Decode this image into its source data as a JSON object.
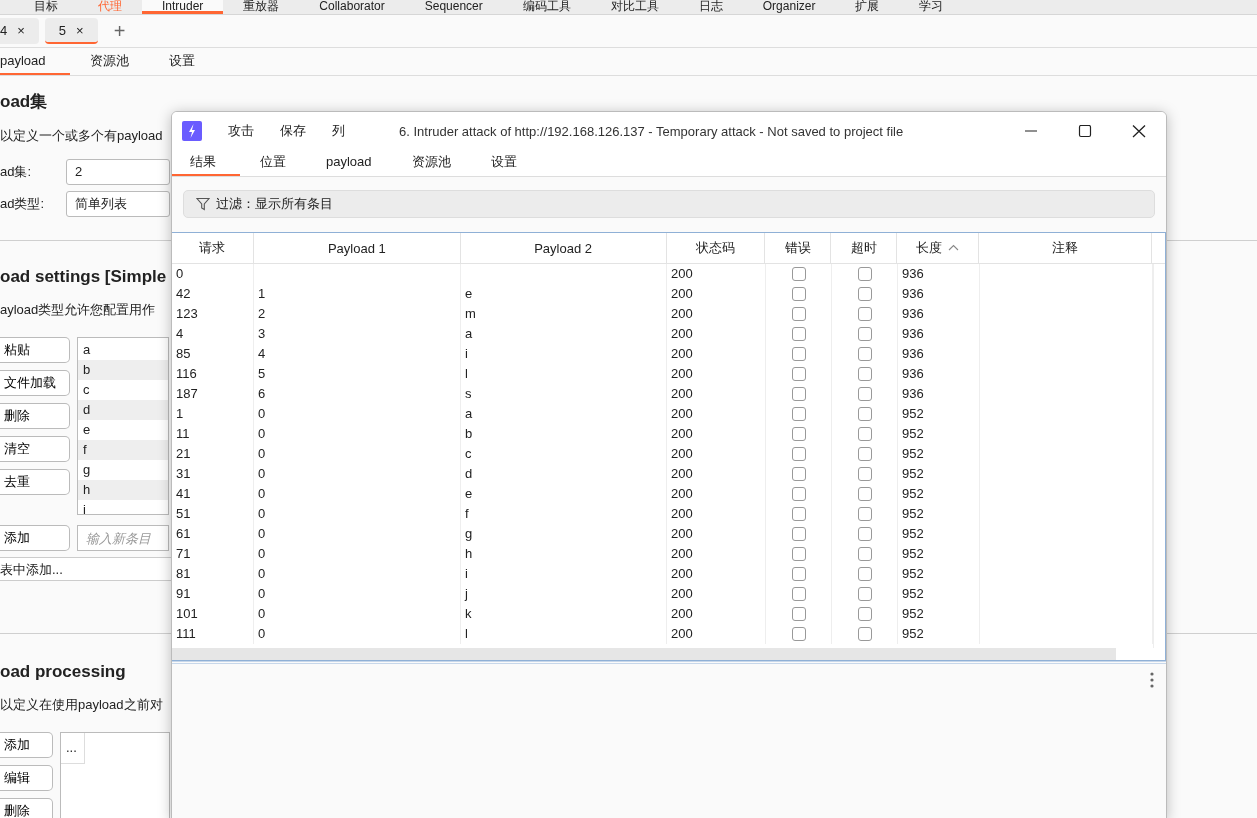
{
  "top_nav": {
    "items": [
      {
        "label": "目标",
        "selected": false,
        "alert": false
      },
      {
        "label": "代理",
        "selected": false,
        "alert": true
      },
      {
        "label": "Intruder",
        "selected": true,
        "alert": false
      },
      {
        "label": "重放器",
        "selected": false,
        "alert": false
      },
      {
        "label": "Collaborator",
        "selected": false,
        "alert": false
      },
      {
        "label": "Sequencer",
        "selected": false,
        "alert": false
      },
      {
        "label": "编码工具",
        "selected": false,
        "alert": false
      },
      {
        "label": "对比工具",
        "selected": false,
        "alert": false
      },
      {
        "label": "日志",
        "selected": false,
        "alert": false
      },
      {
        "label": "Organizer",
        "selected": false,
        "alert": false
      },
      {
        "label": "扩展",
        "selected": false,
        "alert": false
      },
      {
        "label": "学习",
        "selected": false,
        "alert": false
      }
    ]
  },
  "attack_tabs": {
    "items": [
      {
        "label": "4",
        "close": "×",
        "selected": false
      },
      {
        "label": "5",
        "close": "×",
        "selected": true
      }
    ],
    "add": "+"
  },
  "sub_tabs": [
    {
      "label": "payload",
      "selected": true
    },
    {
      "label": "资源池",
      "selected": false
    },
    {
      "label": "设置",
      "selected": false
    }
  ],
  "payload_sets": {
    "heading": "oad集",
    "description": "以定义一个或多个有payload",
    "fields": [
      {
        "label": "ad集:",
        "value": "2"
      },
      {
        "label": "ad类型:",
        "value": "简单列表"
      }
    ]
  },
  "payload_settings": {
    "heading": "oad settings [Simple",
    "description": "ayload类型允许您配置用作",
    "buttons": [
      "粘贴",
      "文件加载",
      "删除",
      "清空",
      "去重"
    ],
    "items": [
      "a",
      "b",
      "c",
      "d",
      "e",
      "f",
      "g",
      "h",
      "i"
    ],
    "add_button": "添加",
    "add_placeholder": "输入新条目",
    "add_from_list": "表中添加..."
  },
  "payload_processing": {
    "heading": "oad processing",
    "description": "以定义在使用payload之前对",
    "buttons": [
      "添加",
      "编辑",
      "删除"
    ],
    "table_header": "..."
  },
  "attack_window": {
    "menu": [
      "攻击",
      "保存",
      "列"
    ],
    "title": "6. Intruder attack of http://192.168.126.137 - Temporary attack - Not saved to project file",
    "tabs": [
      {
        "label": "结果",
        "selected": true
      },
      {
        "label": "位置",
        "selected": false
      },
      {
        "label": "payload",
        "selected": false
      },
      {
        "label": "资源池",
        "selected": false
      },
      {
        "label": "设置",
        "selected": false
      }
    ],
    "filter": "过滤：显示所有条目",
    "table": {
      "columns": [
        {
          "label": "请求",
          "sorted": false
        },
        {
          "label": "Payload 1",
          "sorted": false
        },
        {
          "label": "Payload 2",
          "sorted": false
        },
        {
          "label": "状态码",
          "sorted": false
        },
        {
          "label": "错误",
          "sorted": false
        },
        {
          "label": "超时",
          "sorted": false
        },
        {
          "label": "长度",
          "sorted": true
        },
        {
          "label": "注释",
          "sorted": false
        }
      ],
      "rows": [
        {
          "request": "0",
          "payload_1": "",
          "payload_2": "",
          "status": "200",
          "error": false,
          "timeout": false,
          "length": "936"
        },
        {
          "request": "42",
          "payload_1": "1",
          "payload_2": "e",
          "status": "200",
          "error": false,
          "timeout": false,
          "length": "936"
        },
        {
          "request": "123",
          "payload_1": "2",
          "payload_2": "m",
          "status": "200",
          "error": false,
          "timeout": false,
          "length": "936"
        },
        {
          "request": "4",
          "payload_1": "3",
          "payload_2": "a",
          "status": "200",
          "error": false,
          "timeout": false,
          "length": "936"
        },
        {
          "request": "85",
          "payload_1": "4",
          "payload_2": "i",
          "status": "200",
          "error": false,
          "timeout": false,
          "length": "936"
        },
        {
          "request": "116",
          "payload_1": "5",
          "payload_2": "l",
          "status": "200",
          "error": false,
          "timeout": false,
          "length": "936"
        },
        {
          "request": "187",
          "payload_1": "6",
          "payload_2": "s",
          "status": "200",
          "error": false,
          "timeout": false,
          "length": "936"
        },
        {
          "request": "1",
          "payload_1": "0",
          "payload_2": "a",
          "status": "200",
          "error": false,
          "timeout": false,
          "length": "952"
        },
        {
          "request": "11",
          "payload_1": "0",
          "payload_2": "b",
          "status": "200",
          "error": false,
          "timeout": false,
          "length": "952"
        },
        {
          "request": "21",
          "payload_1": "0",
          "payload_2": "c",
          "status": "200",
          "error": false,
          "timeout": false,
          "length": "952"
        },
        {
          "request": "31",
          "payload_1": "0",
          "payload_2": "d",
          "status": "200",
          "error": false,
          "timeout": false,
          "length": "952"
        },
        {
          "request": "41",
          "payload_1": "0",
          "payload_2": "e",
          "status": "200",
          "error": false,
          "timeout": false,
          "length": "952"
        },
        {
          "request": "51",
          "payload_1": "0",
          "payload_2": "f",
          "status": "200",
          "error": false,
          "timeout": false,
          "length": "952"
        },
        {
          "request": "61",
          "payload_1": "0",
          "payload_2": "g",
          "status": "200",
          "error": false,
          "timeout": false,
          "length": "952"
        },
        {
          "request": "71",
          "payload_1": "0",
          "payload_2": "h",
          "status": "200",
          "error": false,
          "timeout": false,
          "length": "952"
        },
        {
          "request": "81",
          "payload_1": "0",
          "payload_2": "i",
          "status": "200",
          "error": false,
          "timeout": false,
          "length": "952"
        },
        {
          "request": "91",
          "payload_1": "0",
          "payload_2": "j",
          "status": "200",
          "error": false,
          "timeout": false,
          "length": "952"
        },
        {
          "request": "101",
          "payload_1": "0",
          "payload_2": "k",
          "status": "200",
          "error": false,
          "timeout": false,
          "length": "952"
        },
        {
          "request": "111",
          "payload_1": "0",
          "payload_2": "l",
          "status": "200",
          "error": false,
          "timeout": false,
          "length": "952"
        }
      ]
    }
  }
}
